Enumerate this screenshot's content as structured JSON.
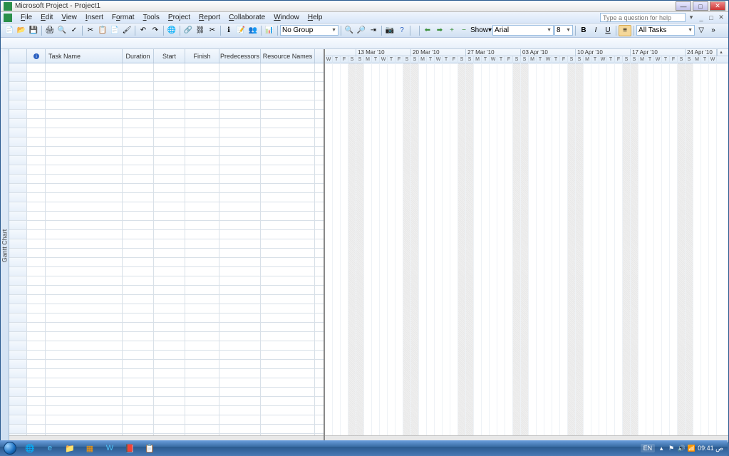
{
  "title": "Microsoft Project - Project1",
  "menu": {
    "file": "File",
    "edit": "Edit",
    "view": "View",
    "insert": "Insert",
    "format": "Format",
    "tools": "Tools",
    "project": "Project",
    "report": "Report",
    "collaborate": "Collaborate",
    "window": "Window",
    "help": "Help"
  },
  "help_placeholder": "Type a question for help",
  "toolbar": {
    "group": "No Group",
    "show": "Show",
    "font": "Arial",
    "size": "8",
    "filter": "All Tasks"
  },
  "columns": {
    "task": "Task Name",
    "dur": "Duration",
    "start": "Start",
    "finish": "Finish",
    "pred": "Predecessors",
    "res": "Resource Names"
  },
  "sidebar_label": "Gantt Chart",
  "weeks": [
    "13 Mar '10",
    "20 Mar '10",
    "27 Mar '10",
    "03 Apr '10",
    "10 Apr '10",
    "17 Apr '10",
    "24 Apr '10"
  ],
  "partial_days_lead": [
    "W",
    "T",
    "F",
    "S"
  ],
  "days": [
    "S",
    "M",
    "T",
    "W",
    "T",
    "F",
    "S"
  ],
  "taskbar": {
    "lang": "EN",
    "time": "09:41 ص"
  }
}
